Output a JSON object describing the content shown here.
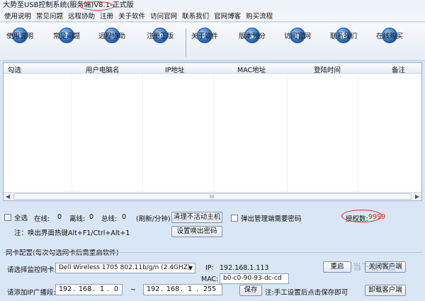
{
  "window": {
    "title_main": "大势至USB控制系统(服务端)V8.1-",
    "title_edition": "正式版"
  },
  "menu": [
    "使用说明",
    "常见问题",
    "远程协助",
    "注册",
    "关于软件",
    "访问官网",
    "联系我们",
    "官网博客",
    "购买流程"
  ],
  "toolbar": [
    {
      "label": "使用说明",
      "icon": "graduation-cap-icon",
      "glyph": "✎"
    },
    {
      "label": "常见问题",
      "icon": "question-icon",
      "glyph": "?"
    },
    {
      "label": "远程协助",
      "icon": "remote-assist-icon",
      "glyph": "☺"
    },
    {
      "label": "注册正版",
      "icon": "registered-icon",
      "glyph": "®"
    },
    {
      "label": "关于软件",
      "icon": "pencil-icon",
      "glyph": "✐"
    },
    {
      "label": "版本划分",
      "icon": "cloud-icon",
      "glyph": "☁"
    },
    {
      "label": "访问官网",
      "icon": "browser-icon",
      "glyph": "e"
    },
    {
      "label": "联系我们",
      "icon": "phone-icon",
      "glyph": "☎"
    },
    {
      "label": "在线购买",
      "icon": "cart-icon",
      "glyph": "🛒"
    }
  ],
  "grid": {
    "columns": [
      "勾选",
      "用户电脑名",
      "IP地址",
      "MAC地址",
      "登陆时间",
      "备注"
    ],
    "grip": "III"
  },
  "status": {
    "select_all": "全选",
    "online_label": "在线:",
    "online_value": "0",
    "offline_label": "离线:",
    "offline_value": "0",
    "total_label": "总线:",
    "total_value": "0",
    "refresh": "(刷新/分钟)",
    "clear_inactive": "清理不活动主机",
    "popup_password": "弹出管理端需要密码",
    "license_label": "授权数:",
    "license_value": "9999",
    "hotkey_note": "注：唤出界面热键Alt+F1/Ctrl+Alt+1",
    "set_popup_password": "设置唤出密码"
  },
  "nic": {
    "section_title": "网卡配置(每次勾选网卡后需重启软件)",
    "select_label": "请选择监控网卡:",
    "selected_nic": "Dell Wireless 1705 802.11b/g/n (2.4GHZ)",
    "ip_label": "IP:",
    "ip_value": "192.168.1.113",
    "mac_label": "MAC:",
    "mac_value": "b0-c0-90-93-dc-cd",
    "restart": "重启",
    "close_client": "关闭客户端",
    "uninstall_client": "卸载客户端",
    "add_ip_label": "请添加IP广播段:",
    "ip_from": [
      "192",
      "168",
      "1",
      "0"
    ],
    "tilde": "~",
    "ip_to": [
      "192",
      "168",
      "1",
      "255"
    ],
    "save": "保存",
    "save_note": "注:手工设置后点击保存即可"
  },
  "watermark": "当下软件园",
  "colors": {
    "annotation": "#e0302a",
    "accent": "#1f5fb4"
  }
}
